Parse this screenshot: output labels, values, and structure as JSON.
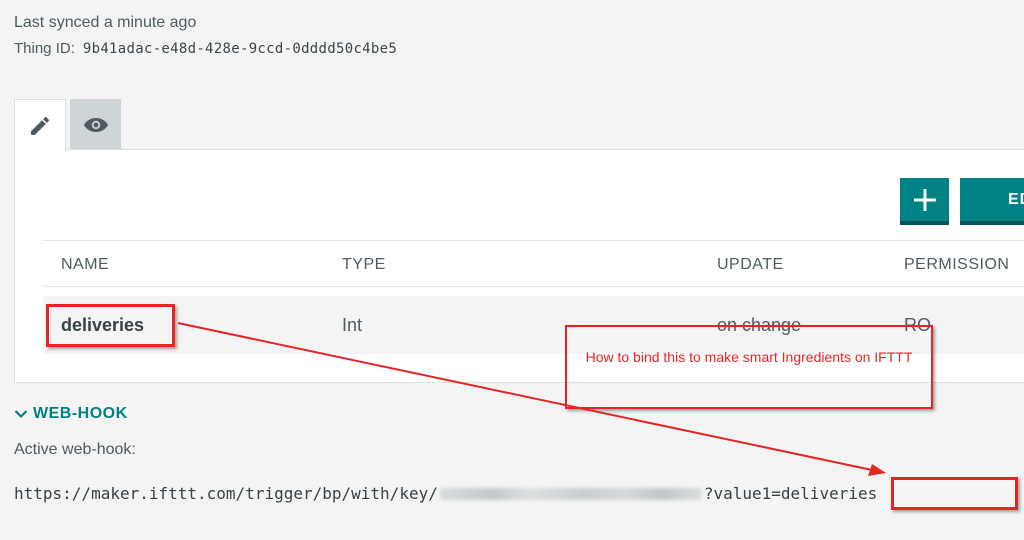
{
  "sync": {
    "last_synced": "Last synced a minute ago"
  },
  "thing": {
    "id_label": "Thing ID:",
    "id_value": "9b41adac-e48d-428e-9ccd-0dddd50c4be5"
  },
  "tabs": [
    {
      "icon": "pencil-icon",
      "active": true
    },
    {
      "icon": "eye-icon",
      "active": false
    }
  ],
  "toolbar": {
    "add_icon": "plus-icon",
    "edit_label": "EDIT"
  },
  "table": {
    "headers": [
      "NAME",
      "TYPE",
      "UPDATE",
      "PERMISSION"
    ],
    "rows": [
      {
        "name": "deliveries",
        "type": "Int",
        "update": "on change",
        "permission": "RO"
      }
    ]
  },
  "webhook": {
    "section_title": "WEB-HOOK",
    "active_label": "Active web-hook:",
    "url_prefix": "https://maker.ifttt.com/trigger/bp/with/key/",
    "url_suffix": "?value1=",
    "url_value": "deliveries"
  },
  "annotation": {
    "note": "How to bind this to make smart Ingredients on IFTTT"
  },
  "colors": {
    "accent": "#008184",
    "annotation": "#e52424",
    "background": "#f4f4f4"
  }
}
